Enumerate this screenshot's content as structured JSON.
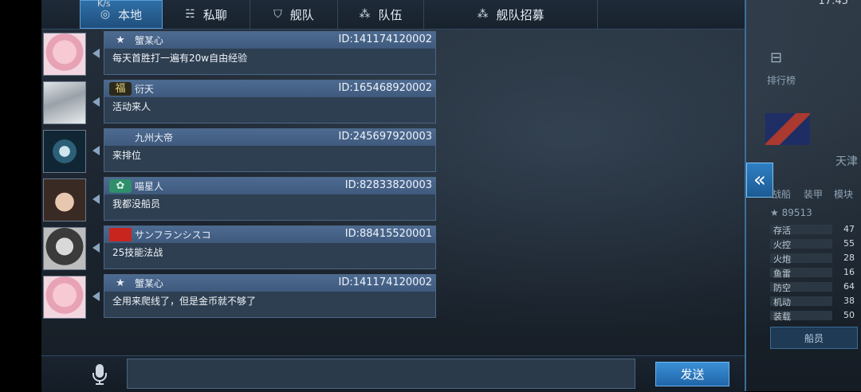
{
  "status_bar": {
    "left": "K/s",
    "right": "17:45"
  },
  "tabs": [
    {
      "label": "本地",
      "icon": "globe-icon",
      "glyph": "◎"
    },
    {
      "label": "私聊",
      "icon": "chat-bubbles-icon",
      "glyph": "☵"
    },
    {
      "label": "舰队",
      "icon": "fleet-icon",
      "glyph": "⛉"
    },
    {
      "label": "队伍",
      "icon": "team-icon",
      "glyph": "⁂"
    },
    {
      "label": "舰队招募",
      "icon": "recruit-icon",
      "glyph": "⁂"
    }
  ],
  "messages": [
    {
      "name": "蟹某心",
      "id": "ID:141174120002",
      "text": "每天首胜打一遍有20w自由经验",
      "badge": "star-emblem",
      "badge_glyph": "★"
    },
    {
      "name": "衍天",
      "id": "ID:165468920002",
      "text": "活动来人",
      "badge": "fu-emblem",
      "badge_glyph": "福"
    },
    {
      "name": "九州大帝",
      "id": "ID:245697920003",
      "text": "来排位",
      "badge": "",
      "badge_glyph": ""
    },
    {
      "name": "喵星人",
      "id": "ID:82833820003",
      "text": "我都没船员",
      "badge": "green-emblem",
      "badge_glyph": "✿"
    },
    {
      "name": "サンフランシスコ",
      "id": "ID:88415520001",
      "text": "25技能法战",
      "badge": "red-flag-emblem",
      "badge_glyph": ""
    },
    {
      "name": "蟹某心",
      "id": "ID:141174120002",
      "text": "全用来爬线了，但是金币就不够了",
      "badge": "star-emblem",
      "badge_glyph": "★"
    }
  ],
  "input": {
    "value": "",
    "placeholder": ""
  },
  "send_label": "发送",
  "hud": {
    "collapse_glyph": "«",
    "rank_label": "排行榜",
    "stars": "★ 89513",
    "tabs": [
      "战船",
      "装甲",
      "模块"
    ],
    "ship_name": "天津",
    "stats": [
      {
        "name": "存活",
        "value": "47"
      },
      {
        "name": "火控",
        "value": "55"
      },
      {
        "name": "火炮",
        "value": "28"
      },
      {
        "name": "鱼雷",
        "value": "16"
      },
      {
        "name": "防空",
        "value": "64"
      },
      {
        "name": "机动",
        "value": "38"
      },
      {
        "name": "装载",
        "value": "50"
      }
    ],
    "crew_label": "船员"
  },
  "colors": {
    "accent": "#2f6fa6",
    "send": "#2a7cc2",
    "bubble_header": "#4a6890"
  }
}
